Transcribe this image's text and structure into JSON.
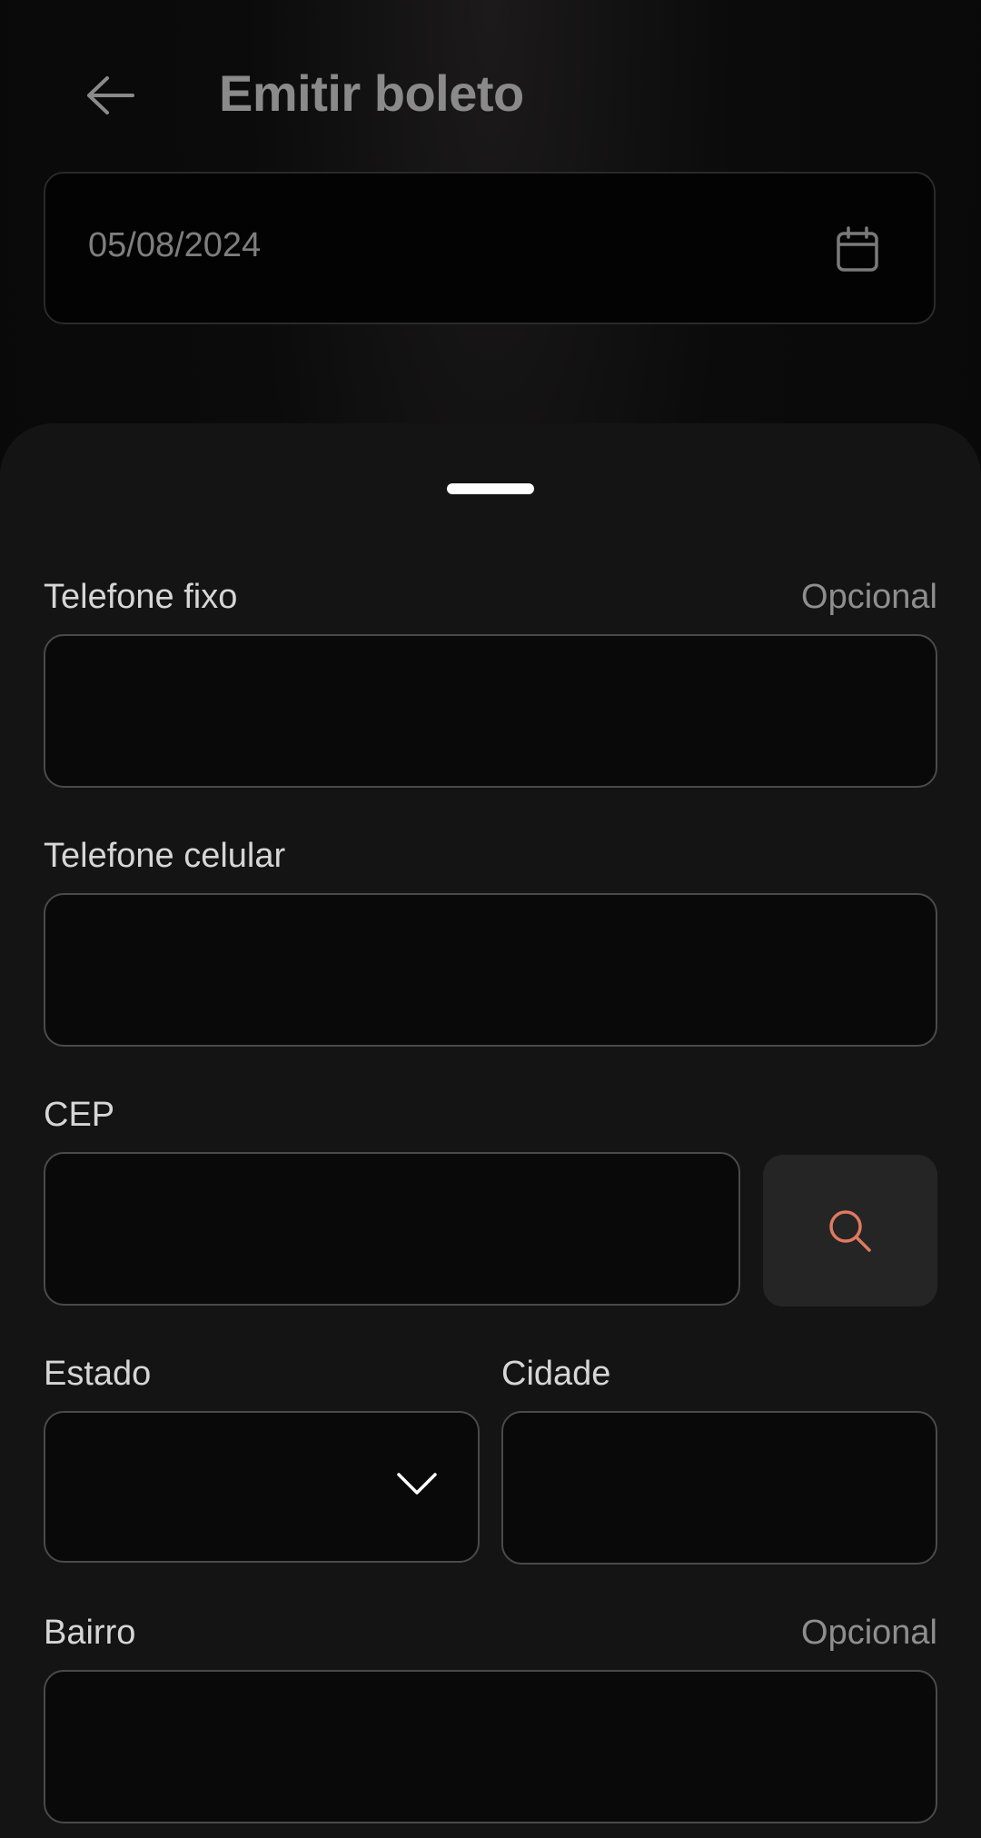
{
  "header": {
    "back_icon": "arrow-left-icon",
    "title": "Emitir boleto"
  },
  "date_field": {
    "value": "05/08/2024",
    "icon": "calendar-icon"
  },
  "form": {
    "telefone_fixo": {
      "label": "Telefone fixo",
      "optional": "Opcional",
      "value": ""
    },
    "telefone_celular": {
      "label": "Telefone celular",
      "value": ""
    },
    "cep": {
      "label": "CEP",
      "value": "",
      "search_icon": "search-icon"
    },
    "estado": {
      "label": "Estado",
      "value": "",
      "icon": "chevron-down-icon"
    },
    "cidade": {
      "label": "Cidade",
      "value": ""
    },
    "bairro": {
      "label": "Bairro",
      "optional": "Opcional",
      "value": ""
    }
  },
  "colors": {
    "accent": "#e07a5f",
    "sheet_background": "#141414",
    "field_border": "#4a4a4a"
  }
}
